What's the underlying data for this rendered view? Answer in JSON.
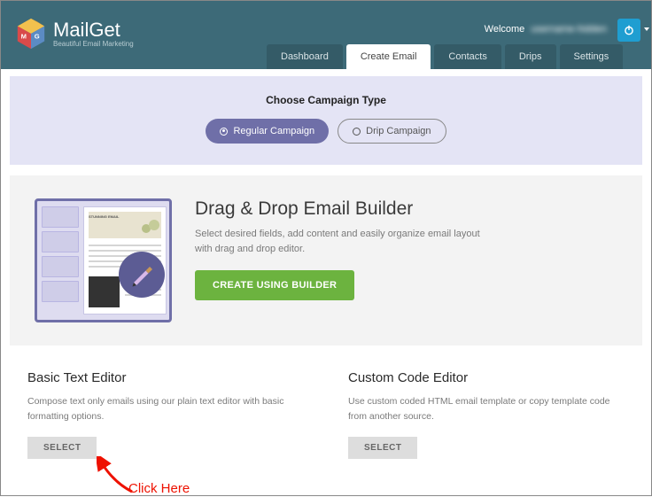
{
  "brand": {
    "name": "MailGet",
    "tagline": "Beautiful Email Marketing"
  },
  "topbar": {
    "welcome": "Welcome",
    "username": "username-hidden"
  },
  "nav": {
    "dashboard": "Dashboard",
    "create_email": "Create Email",
    "contacts": "Contacts",
    "drips": "Drips",
    "settings": "Settings"
  },
  "campaign": {
    "heading": "Choose Campaign Type",
    "regular": "Regular Campaign",
    "drip": "Drip Campaign"
  },
  "builder": {
    "title": "Drag & Drop Email Builder",
    "desc": "Select desired fields, add content and easily organize email layout with drag and drop editor.",
    "cta": "CREATE USING BUILDER",
    "thumb_label": "STUNNING EMAIL"
  },
  "basic": {
    "title": "Basic Text Editor",
    "desc": "Compose text only emails using our plain text editor with basic formatting options.",
    "cta": "SELECT"
  },
  "custom": {
    "title": "Custom Code Editor",
    "desc": "Use custom coded HTML email template or copy template code from another source.",
    "cta": "SELECT"
  },
  "annotation": {
    "text": "Click Here"
  }
}
